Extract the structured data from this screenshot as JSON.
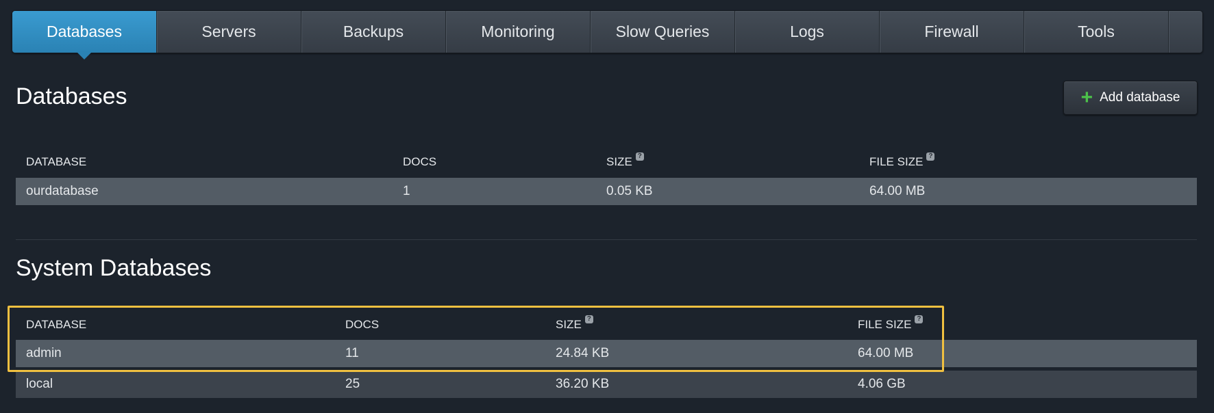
{
  "tabs": [
    {
      "label": "Databases",
      "active": true
    },
    {
      "label": "Servers"
    },
    {
      "label": "Backups"
    },
    {
      "label": "Monitoring"
    },
    {
      "label": "Slow Queries"
    },
    {
      "label": "Logs"
    },
    {
      "label": "Firewall"
    },
    {
      "label": "Tools"
    }
  ],
  "databases": {
    "title": "Databases",
    "add_button": "Add database",
    "columns": [
      "DATABASE",
      "DOCS",
      "SIZE",
      "FILE SIZE"
    ],
    "rows": [
      {
        "name": "ourdatabase",
        "docs": "1",
        "size": "0.05 KB",
        "file_size": "64.00 MB"
      }
    ]
  },
  "system": {
    "title": "System Databases",
    "columns": [
      "DATABASE",
      "DOCS",
      "SIZE",
      "FILE SIZE"
    ],
    "rows": [
      {
        "name": "admin",
        "docs": "11",
        "size": "24.84 KB",
        "file_size": "64.00 MB"
      },
      {
        "name": "local",
        "docs": "25",
        "size": "36.20 KB",
        "file_size": "4.06 GB"
      }
    ]
  },
  "help_icon_glyph": "?",
  "colors": {
    "accent": "#2a82b4",
    "highlight": "#f0c040",
    "add_plus": "#4cc24a"
  }
}
